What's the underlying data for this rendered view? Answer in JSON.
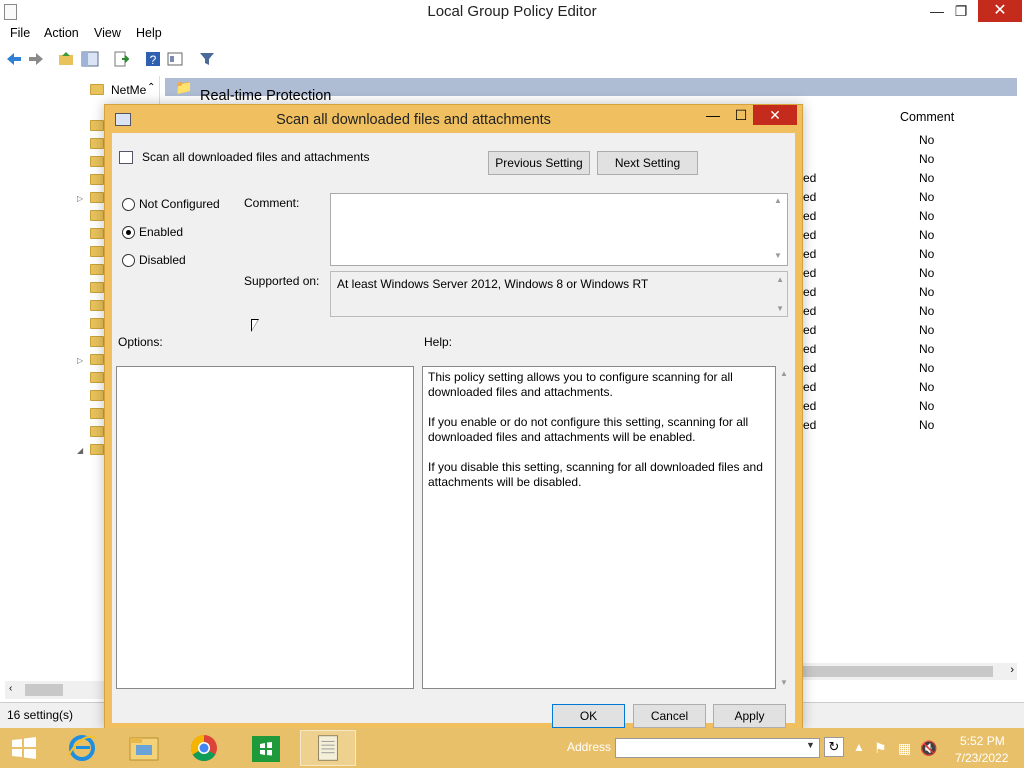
{
  "main_window": {
    "title": "Local Group Policy Editor",
    "menu": [
      "File",
      "Action",
      "View",
      "Help"
    ],
    "tree_label": "NetMe",
    "right_header": "Real-time Protection",
    "comment_column": "Comment",
    "state_col_partial": [
      "ed",
      "ed",
      "ed",
      "ed",
      "ed",
      "ed",
      "ed",
      "ed",
      "ed",
      "ed",
      "ed",
      "ed",
      "ed",
      "ed",
      "ed"
    ],
    "comment_values": [
      "No",
      "No",
      "No",
      "No",
      "No",
      "No",
      "No",
      "No",
      "No",
      "No",
      "No",
      "No",
      "No",
      "No",
      "No",
      "No"
    ],
    "status": "16 setting(s)"
  },
  "dialog": {
    "title": "Scan all downloaded files and attachments",
    "setting_name": "Scan all downloaded files and attachments",
    "prev_button": "Previous Setting",
    "next_button": "Next Setting",
    "radio": {
      "not_configured": "Not Configured",
      "enabled": "Enabled",
      "disabled": "Disabled",
      "selected": "enabled"
    },
    "comment_label": "Comment:",
    "comment_value": "",
    "supported_label": "Supported on:",
    "supported_value": "At least Windows Server 2012, Windows 8 or Windows RT",
    "options_label": "Options:",
    "help_label": "Help:",
    "help_text": [
      "This policy setting allows you to configure scanning for all downloaded files and attachments.",
      "If you enable or do not configure this setting, scanning for all downloaded files and attachments will be enabled.",
      "If you disable this setting, scanning for all downloaded files and attachments will be disabled."
    ],
    "ok": "OK",
    "cancel": "Cancel",
    "apply": "Apply"
  },
  "taskbar": {
    "address_label": "Address",
    "address_value": "",
    "time": "5:52 PM",
    "date": "7/23/2022"
  },
  "colors": {
    "accent": "#f0c060",
    "taskbar": "#e8c06a",
    "close": "#c42b1c"
  }
}
